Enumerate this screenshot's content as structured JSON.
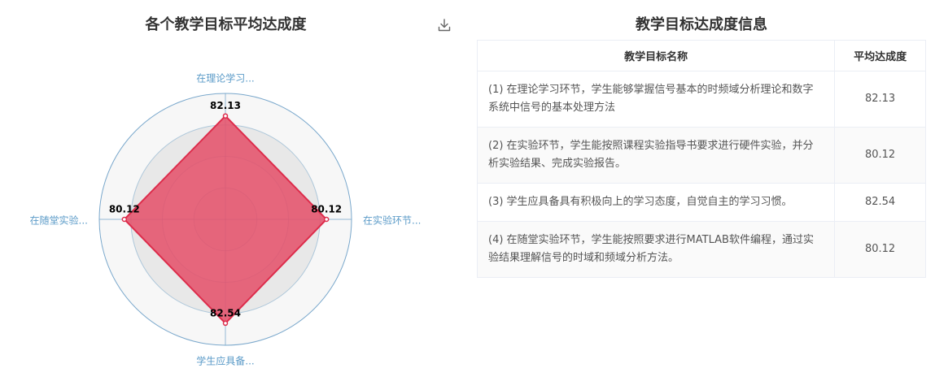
{
  "chart_panel": {
    "title": "各个教学目标平均达成度",
    "download_icon": "download-icon"
  },
  "chart_data": {
    "type": "radar",
    "title": "各个教学目标平均达成度",
    "indicators": [
      "在理论学习...",
      "在实验环节...",
      "学生应具备...",
      "在随堂实验..."
    ],
    "values": [
      82.13,
      80.12,
      82.54,
      80.12
    ],
    "value_labels": [
      "82.13",
      "80.12",
      "82.54",
      "80.12"
    ],
    "max": 100,
    "split_number": 4,
    "fill_color": "#e4526b",
    "line_color": "#dd2c4b",
    "axis_color": "#6c9fc6",
    "split_area_colors": [
      "#f7f7f7",
      "#e8e8e8"
    ]
  },
  "table_panel": {
    "title": "教学目标达成度信息",
    "columns": [
      "教学目标名称",
      "平均达成度"
    ],
    "rows": [
      {
        "name": "(1) 在理论学习环节，学生能够掌握信号基本的时频域分析理论和数字系统中信号的基本处理方法",
        "value": "82.13"
      },
      {
        "name": "(2) 在实验环节，学生能按照课程实验指导书要求进行硬件实验，并分析实验结果、完成实验报告。",
        "value": "80.12"
      },
      {
        "name": "(3) 学生应具备具有积极向上的学习态度，自觉自主的学习习惯。",
        "value": "82.54"
      },
      {
        "name": "(4) 在随堂实验环节，学生能按照要求进行MATLAB软件编程，通过实验结果理解信号的时域和频域分析方法。",
        "value": "80.12"
      }
    ]
  }
}
